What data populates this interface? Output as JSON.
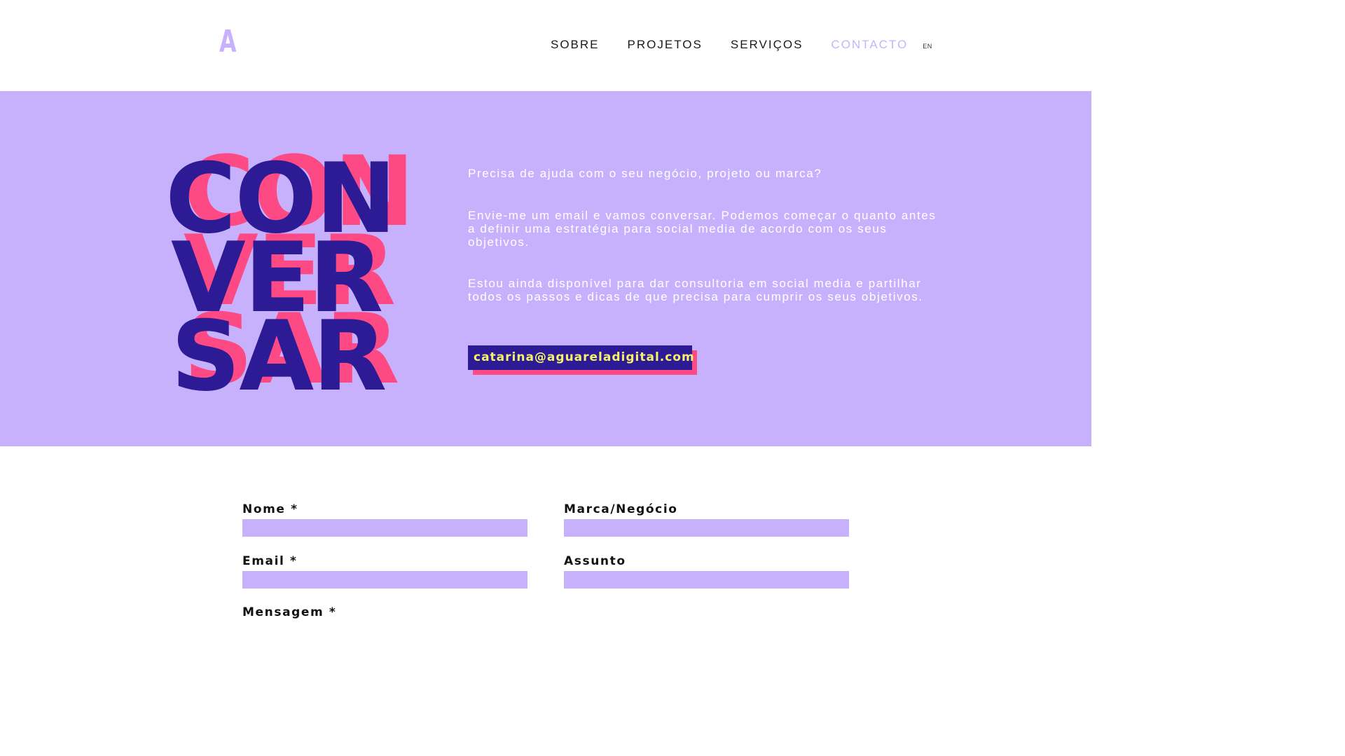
{
  "header": {
    "logo": "A",
    "nav": [
      {
        "label": "SOBRE",
        "active": false
      },
      {
        "label": "PROJETOS",
        "active": false
      },
      {
        "label": "SERVIÇOS",
        "active": false
      },
      {
        "label": "CONTACTO",
        "active": true
      }
    ],
    "lang": "EN"
  },
  "hero": {
    "title_lines": [
      "CON",
      "VER",
      "SAR"
    ],
    "paragraphs": [
      "Precisa de ajuda com o seu negócio, projeto ou marca?",
      "Envie-me um email e vamos conversar. Podemos começar o quanto antes a definir uma estratégia para social media de acordo com os seus objetivos.",
      "Estou ainda disponível para dar consultoria em social media e partilhar todos os passos e dicas de que precisa para cumprir os seus objetivos."
    ],
    "email": "catarina@aguareladigital.com"
  },
  "form": {
    "name_label": "Nome *",
    "brand_label": "Marca/Negócio",
    "email_label": "Email *",
    "subject_label": "Assunto",
    "message_label": "Mensagem *",
    "name_value": "",
    "brand_value": "",
    "email_value": "",
    "subject_value": ""
  },
  "colors": {
    "lavender": "#c8b1fc",
    "navy": "#2d1b96",
    "pink": "#fe4a84",
    "yellow": "#f6f36a"
  }
}
